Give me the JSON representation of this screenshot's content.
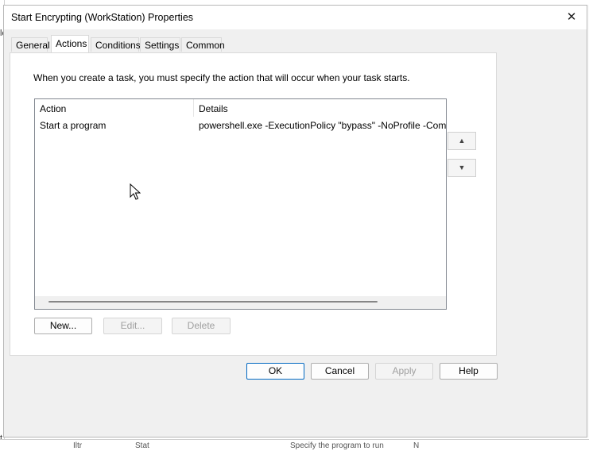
{
  "background_fragments": {
    "left": [
      "le",
      "t"
    ],
    "bottom": [
      "Iltr",
      "Stat",
      "Specify the program to run",
      "N"
    ]
  },
  "dialog": {
    "title": "Start Encrypting (WorkStation) Properties",
    "close_icon": "close-icon"
  },
  "tabs": [
    {
      "label": "General",
      "active": false
    },
    {
      "label": "Actions",
      "active": true
    },
    {
      "label": "Conditions",
      "active": false
    },
    {
      "label": "Settings",
      "active": false
    },
    {
      "label": "Common",
      "active": false
    }
  ],
  "actions_tab": {
    "intro_text": "When you create a task, you must specify the action that will occur when your task starts.",
    "columns": [
      "Action",
      "Details"
    ],
    "rows": [
      {
        "action": "Start a program",
        "details": "powershell.exe -ExecutionPolicy \"bypass\" -NoProfile -Command \\"
      }
    ],
    "move_up_icon": "triangle-up-icon",
    "move_down_icon": "triangle-down-icon",
    "buttons": {
      "new": "New...",
      "edit": "Edit...",
      "delete": "Delete"
    }
  },
  "footer_buttons": {
    "ok": "OK",
    "cancel": "Cancel",
    "apply": "Apply",
    "help": "Help"
  },
  "colors": {
    "dialog_bg": "#f0f0f0",
    "panel_bg": "#ffffff",
    "default_button_border": "#0067c0",
    "disabled_text": "#a0a0a0"
  }
}
